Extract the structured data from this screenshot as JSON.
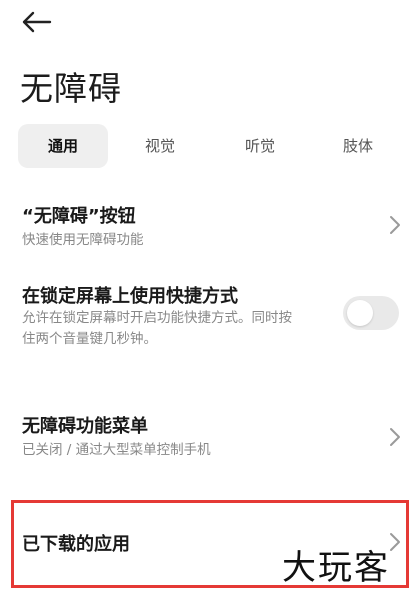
{
  "header": {
    "back_icon": "arrow-left-icon",
    "title": "无障碍"
  },
  "tabs": [
    {
      "label": "通用",
      "active": true
    },
    {
      "label": "视觉",
      "active": false
    },
    {
      "label": "听觉",
      "active": false
    },
    {
      "label": "肢体",
      "active": false
    }
  ],
  "settings": {
    "accessibility_button": {
      "title": "“无障碍”按钮",
      "subtitle": "快速使用无障碍功能"
    },
    "lockscreen_shortcut": {
      "title": "在锁定屏幕上使用快捷方式",
      "subtitle_line1": "允许在锁定屏幕时开启功能快捷方式。同时按",
      "subtitle_line2": "住两个音量键几秒钟。",
      "toggle_on": false
    },
    "accessibility_menu": {
      "title": "无障碍功能菜单",
      "subtitle": "已关闭 / 通过大型菜单控制手机"
    },
    "downloaded_apps": {
      "title": "已下载的应用"
    }
  },
  "watermark": "大玩客",
  "colors": {
    "highlight": "#e53935",
    "tab_active_bg": "#efefef",
    "toggle_off_bg": "#e9e9e9"
  }
}
